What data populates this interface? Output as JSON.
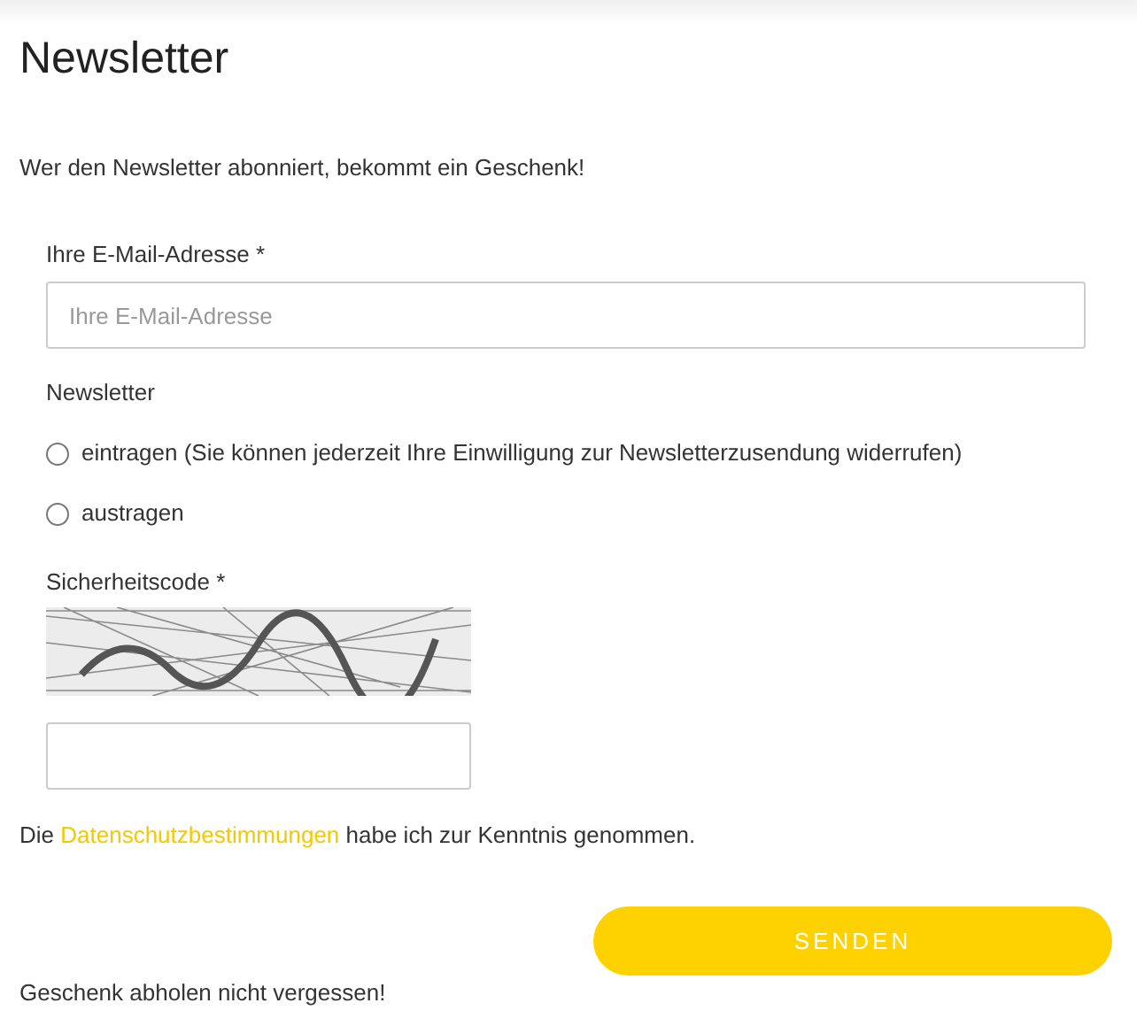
{
  "title": "Newsletter",
  "intro": "Wer den Newsletter abonniert, bekommt ein Geschenk!",
  "email": {
    "label": "Ihre E-Mail-Adresse *",
    "placeholder": "Ihre E-Mail-Adresse"
  },
  "newsletter": {
    "label": "Newsletter",
    "options": [
      {
        "label": "eintragen (Sie können jederzeit Ihre Einwilligung zur Newsletterzusendung widerrufen)",
        "selected": false
      },
      {
        "label": "austragen",
        "selected": false
      }
    ]
  },
  "captcha": {
    "label": "Sicherheitscode *"
  },
  "privacy": {
    "before": "Die",
    "link": "Datenschutzbestimmungen",
    "after": "habe ich zur Kenntnis genommen."
  },
  "submit": "SENDEN",
  "footer": "Geschenk abholen nicht vergessen!"
}
